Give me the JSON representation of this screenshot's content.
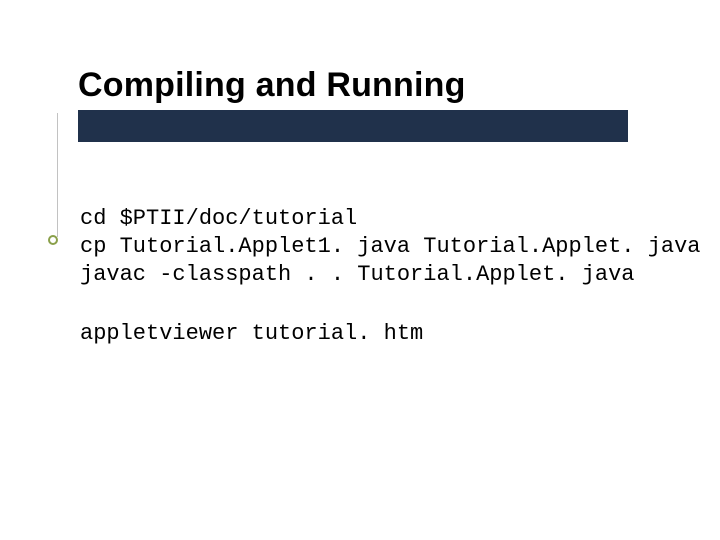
{
  "slide": {
    "title": "Compiling and Running",
    "code_block_1": "cd $PTII/doc/tutorial\ncp Tutorial.Applet1. java Tutorial.Applet. java\njavac -classpath . . Tutorial.Applet. java",
    "code_block_2": "appletviewer tutorial. htm"
  }
}
